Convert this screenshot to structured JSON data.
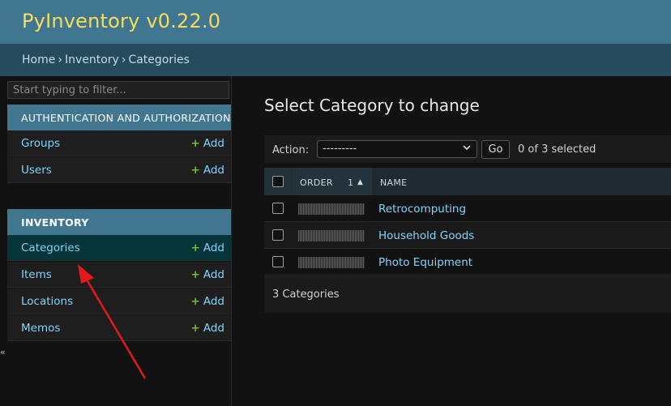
{
  "header": {
    "title": "PyInventory v0.22.0"
  },
  "breadcrumbs": [
    "Home",
    "Inventory",
    "Categories"
  ],
  "breadcrumb_separator": "›",
  "sidebar": {
    "filter_placeholder": "Start typing to filter...",
    "sections": [
      {
        "caption": "AUTHENTICATION AND AUTHORIZATION",
        "items": [
          {
            "label": "Groups",
            "add": "Add"
          },
          {
            "label": "Users",
            "add": "Add"
          }
        ]
      },
      {
        "caption": "INVENTORY",
        "items": [
          {
            "label": "Categories",
            "add": "Add",
            "selected": true
          },
          {
            "label": "Items",
            "add": "Add"
          },
          {
            "label": "Locations",
            "add": "Add"
          },
          {
            "label": "Memos",
            "add": "Add"
          }
        ]
      }
    ],
    "toggle_glyph": "«",
    "add_plus": "+"
  },
  "main": {
    "title": "Select Category to change",
    "actions": {
      "label": "Action:",
      "selected": "---------",
      "go": "Go",
      "counter": "0 of 3 selected"
    },
    "table": {
      "columns": {
        "order": "ORDER",
        "sort_rank": "1",
        "sort_arrow": "▲",
        "name": "NAME"
      },
      "rows": [
        {
          "name": "Retrocomputing"
        },
        {
          "name": "Household Goods"
        },
        {
          "name": "Photo Equipment"
        }
      ]
    },
    "paginator": "3 Categories"
  },
  "colors": {
    "header_bg": "#417690",
    "title": "#f5dd5d",
    "link": "#81d4fa",
    "add_plus": "#70bf2b",
    "annotation_arrow": "#e31a1a"
  }
}
